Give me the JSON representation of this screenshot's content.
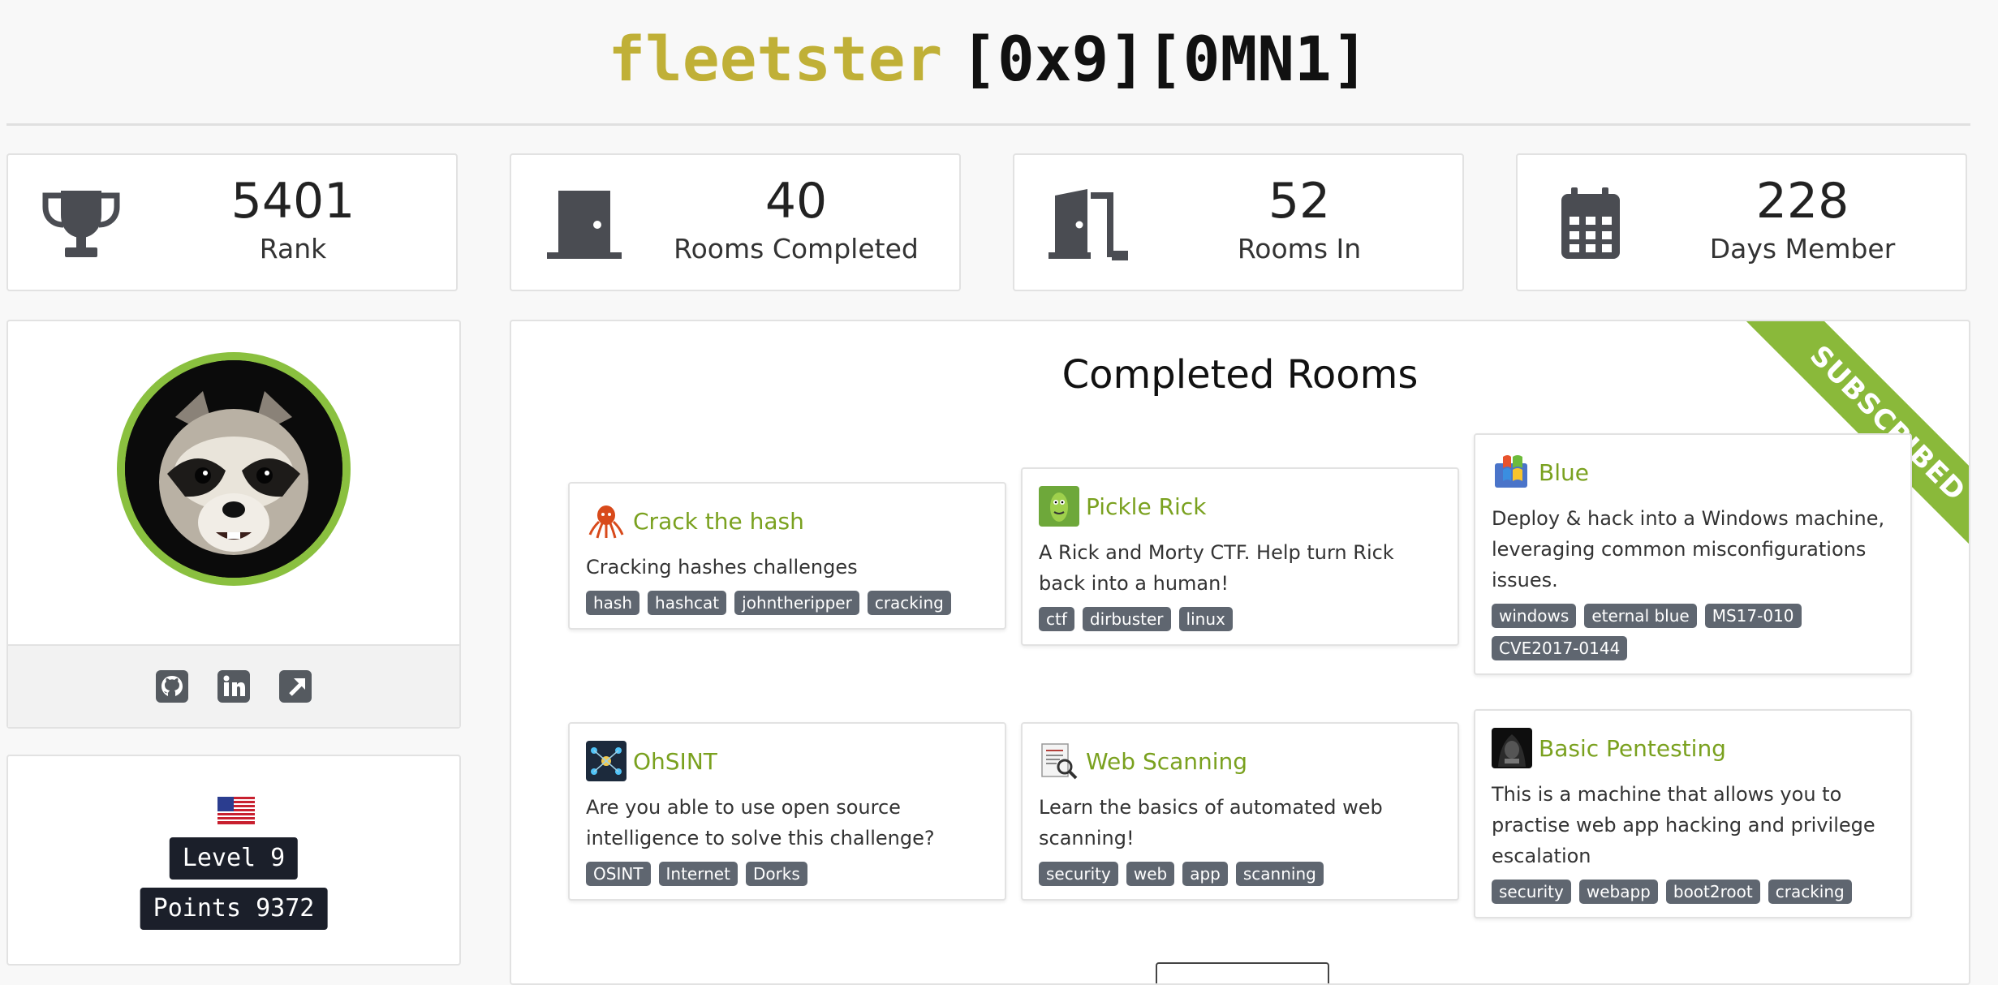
{
  "header": {
    "username": "fleetster",
    "tag": "[0x9][0MN1]"
  },
  "stats": [
    {
      "value": "5401",
      "label": "Rank",
      "icon": "trophy-icon"
    },
    {
      "value": "40",
      "label": "Rooms Completed",
      "icon": "door-closed-icon"
    },
    {
      "value": "52",
      "label": "Rooms In",
      "icon": "door-open-icon"
    },
    {
      "value": "228",
      "label": "Days Member",
      "icon": "calendar-icon"
    }
  ],
  "profile": {
    "avatar": "raccoon-avatar",
    "links": [
      "github-icon",
      "linkedin-icon",
      "external-link-icon"
    ]
  },
  "level": {
    "flag": "us-flag-icon",
    "level_label": "Level 9",
    "points_label": "Points 9372"
  },
  "rooms": {
    "title": "Completed Rooms",
    "ribbon": "SUBSCRIBED",
    "items": [
      {
        "name": "Crack the hash",
        "desc": "Cracking hashes challenges",
        "tags": [
          "hash",
          "hashcat",
          "johntheripper",
          "cracking"
        ],
        "icon": "octopus-icon"
      },
      {
        "name": "Pickle Rick",
        "desc": "A Rick and Morty CTF. Help turn Rick back into a human!",
        "tags": [
          "ctf",
          "dirbuster",
          "linux"
        ],
        "icon": "pickle-rick-icon"
      },
      {
        "name": "Blue",
        "desc": "Deploy & hack into a Windows machine, leveraging common misconfigurations issues.",
        "tags": [
          "windows",
          "eternal blue",
          "MS17-010",
          "CVE2017-0144"
        ],
        "icon": "windows-logo-icon"
      },
      {
        "name": "OhSINT",
        "desc": "Are you able to use open source intelligence to solve this challenge?",
        "tags": [
          "OSINT",
          "Internet",
          "Dorks"
        ],
        "icon": "network-icon"
      },
      {
        "name": "Web Scanning",
        "desc": "Learn the basics of automated web scanning!",
        "tags": [
          "security",
          "web",
          "app",
          "scanning"
        ],
        "icon": "magnifier-document-icon"
      },
      {
        "name": "Basic Pentesting",
        "desc": "This is a machine that allows you to practise web app hacking and privilege escalation",
        "tags": [
          "security",
          "webapp",
          "boot2root",
          "cracking"
        ],
        "icon": "hooded-hacker-icon"
      }
    ]
  },
  "colors": {
    "username": "#c0b037",
    "accent_green": "#8ab93a",
    "room_title": "#7aa11f",
    "tag_bg": "#5f6670",
    "badge_bg": "#1b1f2a"
  }
}
